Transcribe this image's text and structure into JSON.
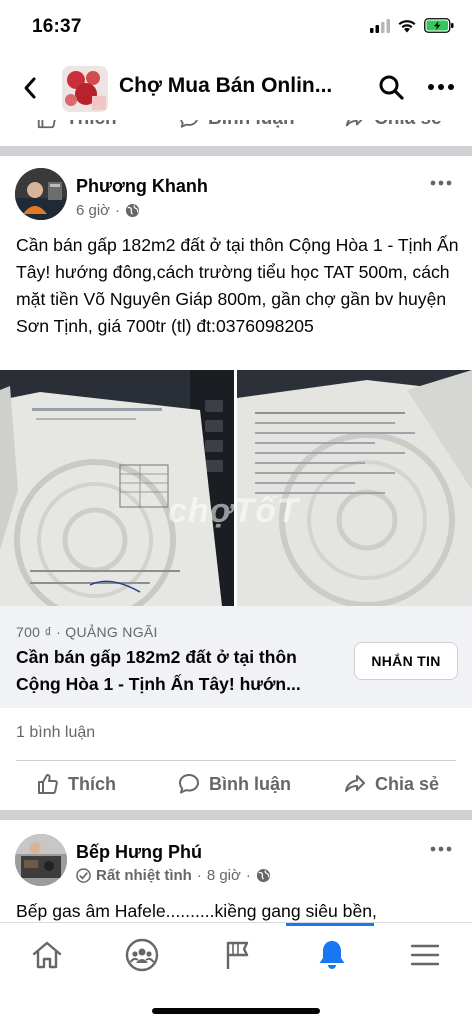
{
  "status": {
    "time": "16:37"
  },
  "header": {
    "group_name": "Chợ Mua Bán Onlin..."
  },
  "prev_actions": {
    "like": "Thích",
    "comment": "Bình luận",
    "share": "Chia sẻ"
  },
  "post": {
    "author": "Phương Khanh",
    "time": "6 giờ",
    "dot": "·",
    "text": "Cần bán gấp 182m2 đất ở tại thôn Cộng Hòa 1 - Tịnh Ấn Tây! hướng đông,cách trường tiểu học TAT 500m, cách mặt tiền Võ Nguyên Giáp 800m, gần chợ gần bv huyện Sơn Tịnh,  giá 700tr (tl) đt:0376098205",
    "watermark": "chợTốT",
    "listing": {
      "price_location": "700 ₫ · QUẢNG NGÃI",
      "title": "Cần bán gấp 182m2 đất ở tại thôn Cộng Hòa 1 - Tịnh Ấn Tây! hướn...",
      "button": "NHẮN TIN"
    },
    "comment_count": "1 bình luận",
    "actions": {
      "like": "Thích",
      "comment": "Bình luận",
      "share": "Chia sẻ"
    }
  },
  "post2": {
    "author": "Bếp Hưng Phú",
    "badge": "Rất nhiệt tình",
    "time": "8 giờ",
    "dot": "·",
    "text": "Bếp gas âm Hafele..........kiềng gang siêu bền,"
  },
  "tabbar": {
    "items": [
      "home-icon",
      "groups-icon",
      "pages-flag-icon",
      "notifications-bell-icon",
      "menu-icon"
    ],
    "active": "notifications-bell-icon",
    "accent": "#1877f2"
  },
  "colors": {
    "accent": "#1877f2",
    "secondary_text": "#65676b",
    "separator": "#ced0d4",
    "battery": "#34c759"
  }
}
